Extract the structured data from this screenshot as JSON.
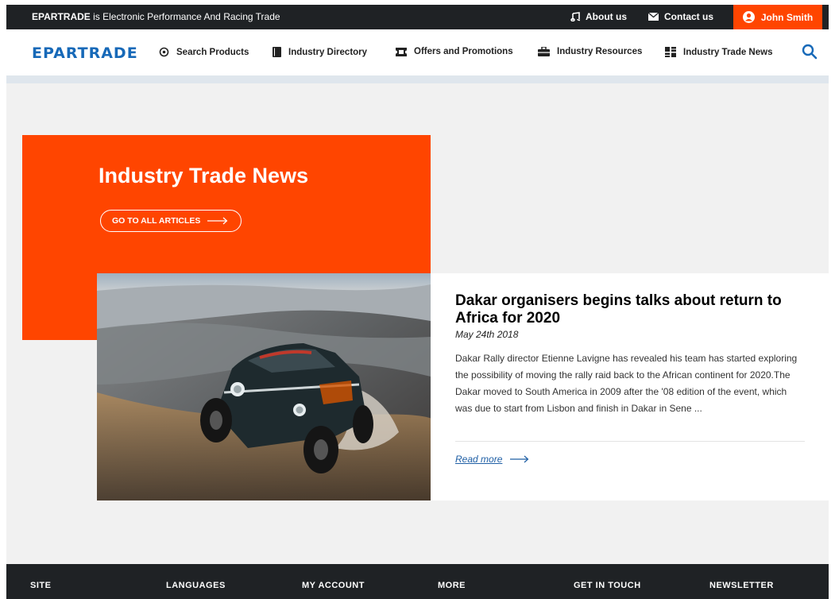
{
  "topbar": {
    "brand": "EPARTRADE",
    "tagline_rest": " is Electronic Performance And Racing Trade",
    "about": "About us",
    "contact": "Contact us",
    "user": "John Smith"
  },
  "nav": {
    "logo": "EPARTRADE",
    "items": [
      {
        "label": "Search Products",
        "icon": "target-icon"
      },
      {
        "label": "Industry Directory",
        "icon": "book-icon"
      },
      {
        "label": "Offers and Promotions",
        "icon": "ticket-icon"
      },
      {
        "label": "Industry Resources",
        "icon": "toolbox-icon"
      },
      {
        "label": "Industry Trade News",
        "icon": "news-icon"
      }
    ]
  },
  "hero": {
    "title": "Industry Trade News",
    "button": "GO TO ALL ARTICLES"
  },
  "article": {
    "headline": "Dakar organisers begins talks about return to Africa for 2020",
    "date": "May 24th 2018",
    "excerpt": "Dakar Rally director Etienne Lavigne has revealed his team has started exploring the possibility of moving the rally raid back to the African continent for 2020.The Dakar moved to South America in 2009 after the '08 edition of the event, which was due to start from Lisbon and finish in Dakar in Sene ...",
    "read_more": "Read more"
  },
  "footer": {
    "site": "SITE",
    "languages": "LANGUAGES",
    "account": "MY ACCOUNT",
    "more": "MORE",
    "touch": "GET IN TOUCH",
    "newsletter": "NEWSLETTER"
  },
  "colors": {
    "accent": "#ff4500",
    "dark": "#1f2225",
    "link": "#1f5fa5",
    "logo": "#1769b8"
  }
}
